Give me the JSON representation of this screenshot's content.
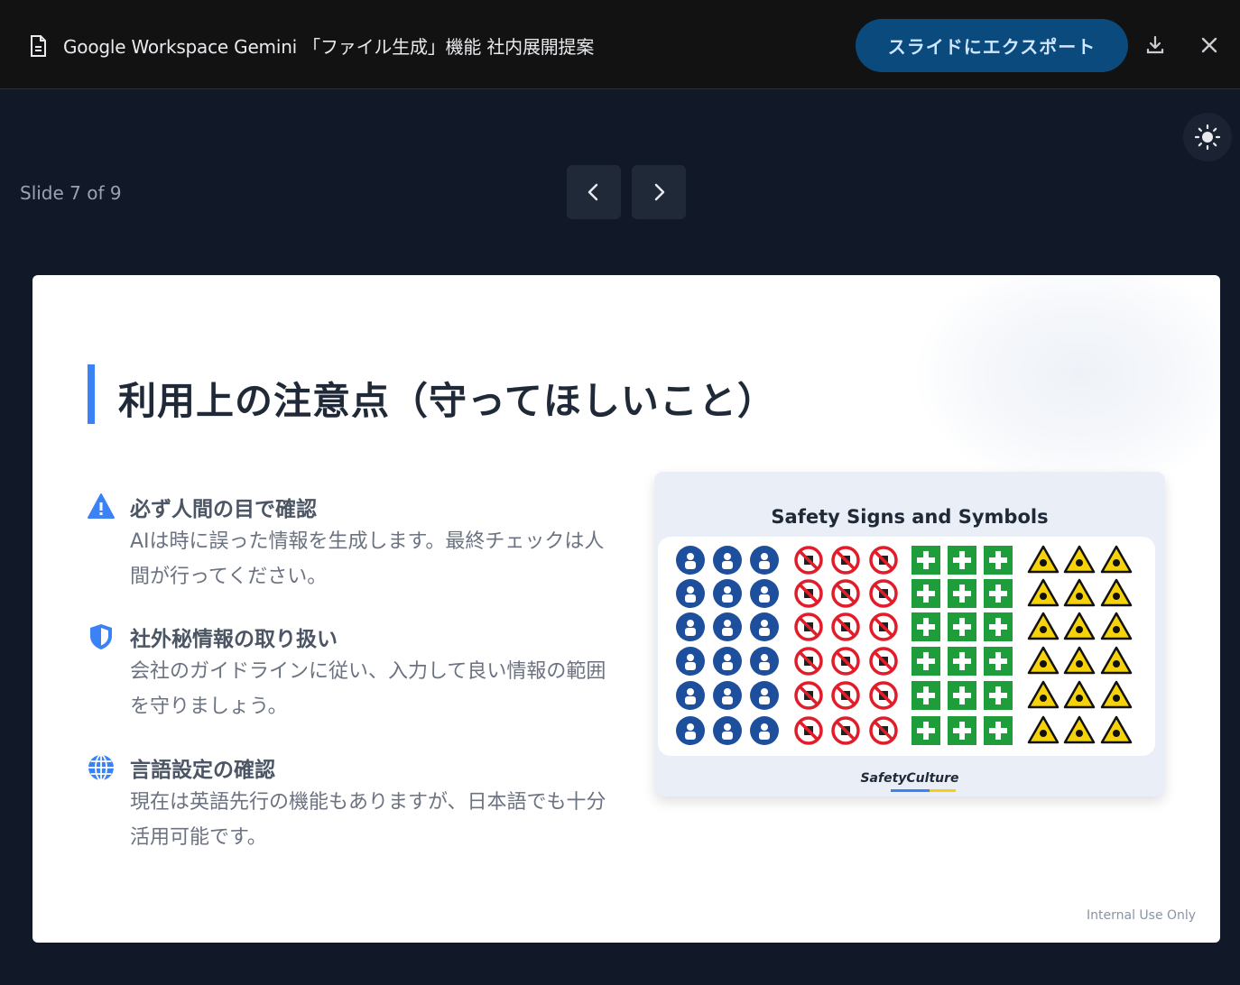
{
  "header": {
    "title": "Google Workspace Gemini 「ファイル生成」機能 社内展開提案",
    "export_label": "スライドにエクスポート",
    "doc_icon": "document-icon",
    "download_icon": "download-icon",
    "close_icon": "close-icon"
  },
  "viewer": {
    "slide_counter": "Slide 7 of 9",
    "prev_icon": "chevron-left-icon",
    "next_icon": "chevron-right-icon",
    "theme_icon": "sun-icon"
  },
  "slide": {
    "heading": "利用上の注意点（守ってほしいこと）",
    "items": [
      {
        "icon": "warning-icon",
        "title": "必ず人間の目で確認",
        "body": "AIは時に誤った情報を生成します。最終チェックは人間が行ってください。"
      },
      {
        "icon": "shield-icon",
        "title": "社外秘情報の取り扱い",
        "body": "会社のガイドラインに従い、入力して良い情報の範囲を守りましょう。"
      },
      {
        "icon": "globe-icon",
        "title": "言語設定の確認",
        "body": "現在は英語先行の機能もありますが、日本語でも十分活用可能です。"
      }
    ],
    "image": {
      "title": "Safety Signs and Symbols",
      "brand": "SafetyCulture"
    },
    "footer": "Internal Use Only"
  },
  "colors": {
    "accent": "#3b82f6",
    "export_button": "#0b4a7d",
    "mandatory_blue": "#1d4f9c",
    "prohibition_red": "#e11d2a",
    "safe_green": "#1f9d3a",
    "warning_yellow": "#f6d20a"
  }
}
